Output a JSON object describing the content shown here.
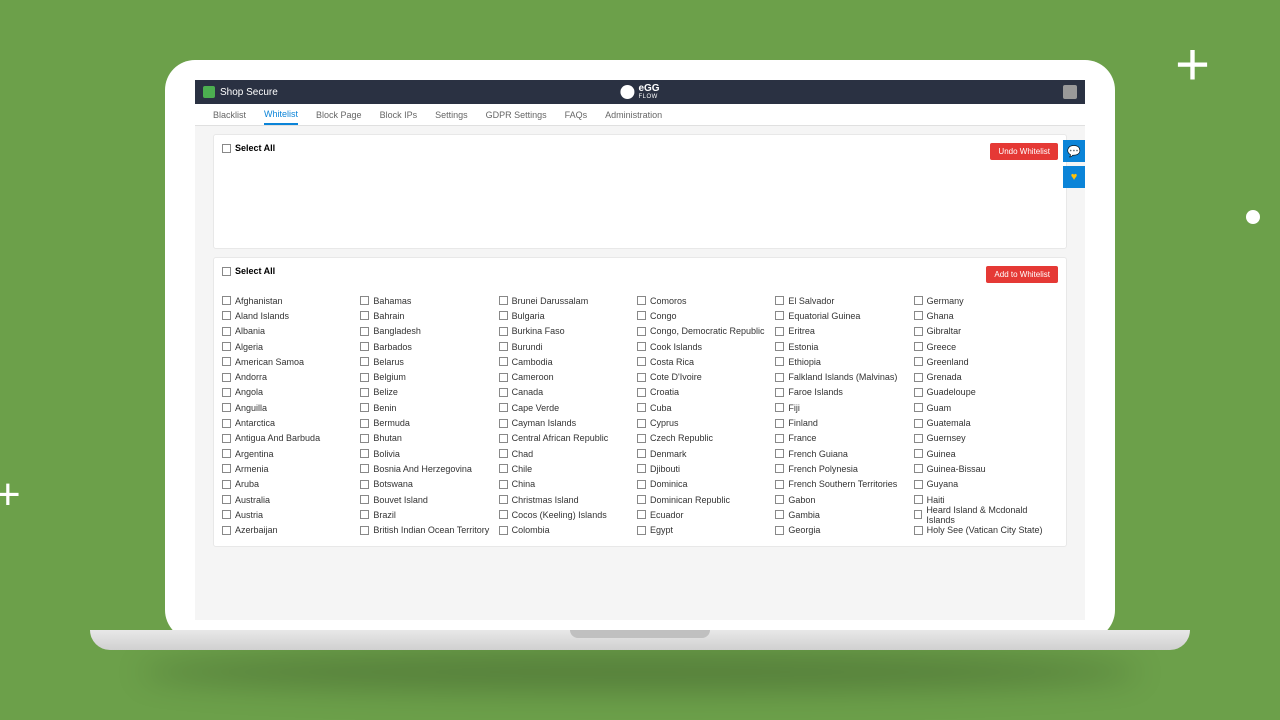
{
  "header": {
    "app_name": "Shop Secure",
    "brand_top": "eGG",
    "brand_bottom": "FLOW"
  },
  "tabs": [
    "Blacklist",
    "Whitelist",
    "Block Page",
    "Block IPs",
    "Settings",
    "GDPR Settings",
    "FAQs",
    "Administration"
  ],
  "active_tab": 1,
  "panel1": {
    "select_all": "Select All",
    "undo_btn": "Undo Whitelist"
  },
  "panel2": {
    "select_all": "Select All",
    "add_btn": "Add to Whitelist"
  },
  "countries": [
    "Afghanistan",
    "Aland Islands",
    "Albania",
    "Algeria",
    "American Samoa",
    "Andorra",
    "Angola",
    "Anguilla",
    "Antarctica",
    "Antigua And Barbuda",
    "Argentina",
    "Armenia",
    "Aruba",
    "Australia",
    "Austria",
    "Azerbaijan",
    "Bahamas",
    "Bahrain",
    "Bangladesh",
    "Barbados",
    "Belarus",
    "Belgium",
    "Belize",
    "Benin",
    "Bermuda",
    "Bhutan",
    "Bolivia",
    "Bosnia And Herzegovina",
    "Botswana",
    "Bouvet Island",
    "Brazil",
    "British Indian Ocean Territory",
    "Brunei Darussalam",
    "Bulgaria",
    "Burkina Faso",
    "Burundi",
    "Cambodia",
    "Cameroon",
    "Canada",
    "Cape Verde",
    "Cayman Islands",
    "Central African Republic",
    "Chad",
    "Chile",
    "China",
    "Christmas Island",
    "Cocos (Keeling) Islands",
    "Colombia",
    "Comoros",
    "Congo",
    "Congo, Democratic Republic",
    "Cook Islands",
    "Costa Rica",
    "Cote D'Ivoire",
    "Croatia",
    "Cuba",
    "Cyprus",
    "Czech Republic",
    "Denmark",
    "Djibouti",
    "Dominica",
    "Dominican Republic",
    "Ecuador",
    "Egypt",
    "El Salvador",
    "Equatorial Guinea",
    "Eritrea",
    "Estonia",
    "Ethiopia",
    "Falkland Islands (Malvinas)",
    "Faroe Islands",
    "Fiji",
    "Finland",
    "France",
    "French Guiana",
    "French Polynesia",
    "French Southern Territories",
    "Gabon",
    "Gambia",
    "Georgia",
    "Germany",
    "Ghana",
    "Gibraltar",
    "Greece",
    "Greenland",
    "Grenada",
    "Guadeloupe",
    "Guam",
    "Guatemala",
    "Guernsey",
    "Guinea",
    "Guinea-Bissau",
    "Guyana",
    "Haiti",
    "Heard Island & Mcdonald Islands",
    "Holy See (Vatican City State)"
  ]
}
